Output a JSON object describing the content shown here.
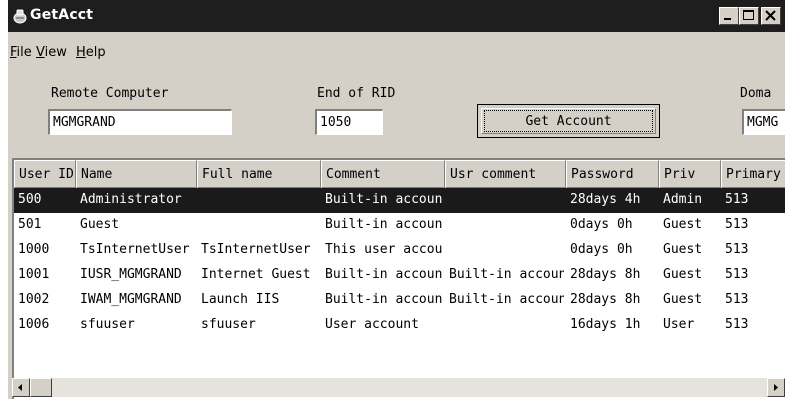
{
  "window": {
    "title": "GetAcct",
    "icon": "app-icon",
    "controls": [
      "minimize-icon",
      "maximize-icon",
      "close-icon"
    ]
  },
  "menu": {
    "file": {
      "accel": "F",
      "rest": "ile"
    },
    "view": {
      "accel": "V",
      "rest": "iew"
    },
    "help": {
      "accel": "H",
      "rest": "elp"
    }
  },
  "form": {
    "remote_computer_label": "Remote Computer",
    "remote_computer_value": "MGMGRAND",
    "end_of_rid_label": "End of RID",
    "end_of_rid_value": "1050",
    "get_account_button": "Get Account",
    "domain_label": "Doma",
    "domain_value": "MGMG"
  },
  "table": {
    "columns": [
      "User ID",
      "Name",
      "Full name",
      "Comment",
      "Usr comment",
      "Password",
      "Priv",
      "Primary"
    ],
    "selected_row": 0,
    "rows": [
      [
        "500",
        "Administrator",
        "",
        "Built-in account",
        "",
        "28days 4h",
        "Admin",
        "513"
      ],
      [
        "501",
        "Guest",
        "",
        "Built-in account",
        "",
        "0days 0h",
        "Guest",
        "513"
      ],
      [
        "1000",
        "TsInternetUser",
        "TsInternetUser",
        "This user account",
        "",
        "0days 0h",
        "Guest",
        "513"
      ],
      [
        "1001",
        "IUSR_MGMGRAND",
        "Internet Guest",
        "Built-in account",
        "Built-in account",
        "28days 8h",
        "Guest",
        "513"
      ],
      [
        "1002",
        "IWAM_MGMGRAND",
        "Launch IIS",
        "Built-in account",
        "Built-in account",
        "28days 8h",
        "Guest",
        "513"
      ],
      [
        "1006",
        "sfuuser",
        "sfuuser",
        "User account",
        "",
        "16days 1h",
        "User",
        "513"
      ]
    ]
  },
  "scrollbar": {
    "left_arrow": "left-arrow-icon",
    "right_arrow": "right-arrow-icon"
  },
  "colors": {
    "face": "#d4d0c8",
    "titlebar": "#1e1e1e",
    "selection": "#1a1a1a"
  }
}
